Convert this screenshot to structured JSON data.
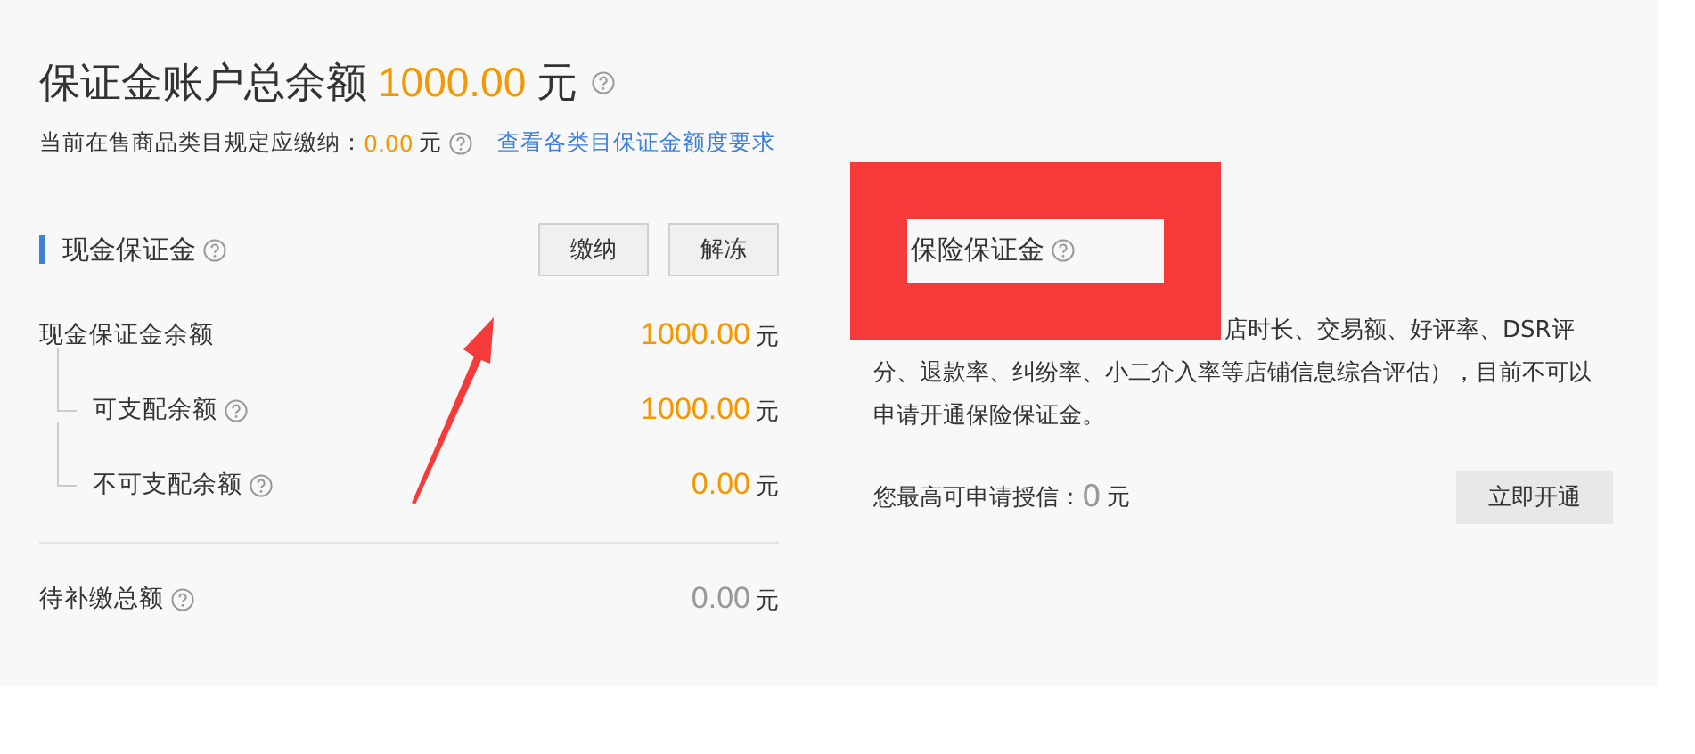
{
  "header": {
    "title": "保证金账户总余额",
    "amount": "1000.00",
    "unit": "元"
  },
  "requirement": {
    "label": "当前在售商品类目规定应缴纳：",
    "amount": "0.00",
    "unit": "元",
    "link": "查看各类目保证金额度要求"
  },
  "cash_deposit": {
    "title": "现金保证金",
    "buttons": [
      "缴纳",
      "解冻"
    ],
    "rows": [
      {
        "label": "现金保证金余额",
        "amount": "1000.00",
        "unit": "元",
        "highlighted": true,
        "help": false,
        "children": [
          {
            "label": "可支配余额",
            "amount": "1000.00",
            "unit": "元",
            "highlighted": true,
            "help": true
          },
          {
            "label": "不可支配余额",
            "amount": "0.00",
            "unit": "元",
            "highlighted": true,
            "help": true
          }
        ]
      }
    ],
    "pending": {
      "label": "待补缴总额",
      "amount": "0.00",
      "unit": "元",
      "highlighted": false,
      "help": true
    }
  },
  "insurance_deposit": {
    "title": "保险保证金",
    "description": "店时长、交易额、好评率、DSR评分、退款率、纠纷率、小二介入率等店铺信息综合评估），目前不可以申请开通保险保证金。",
    "credit_label": "您最高可申请授信：",
    "credit_amount": "0",
    "unit": "元",
    "button": "立即开通"
  }
}
